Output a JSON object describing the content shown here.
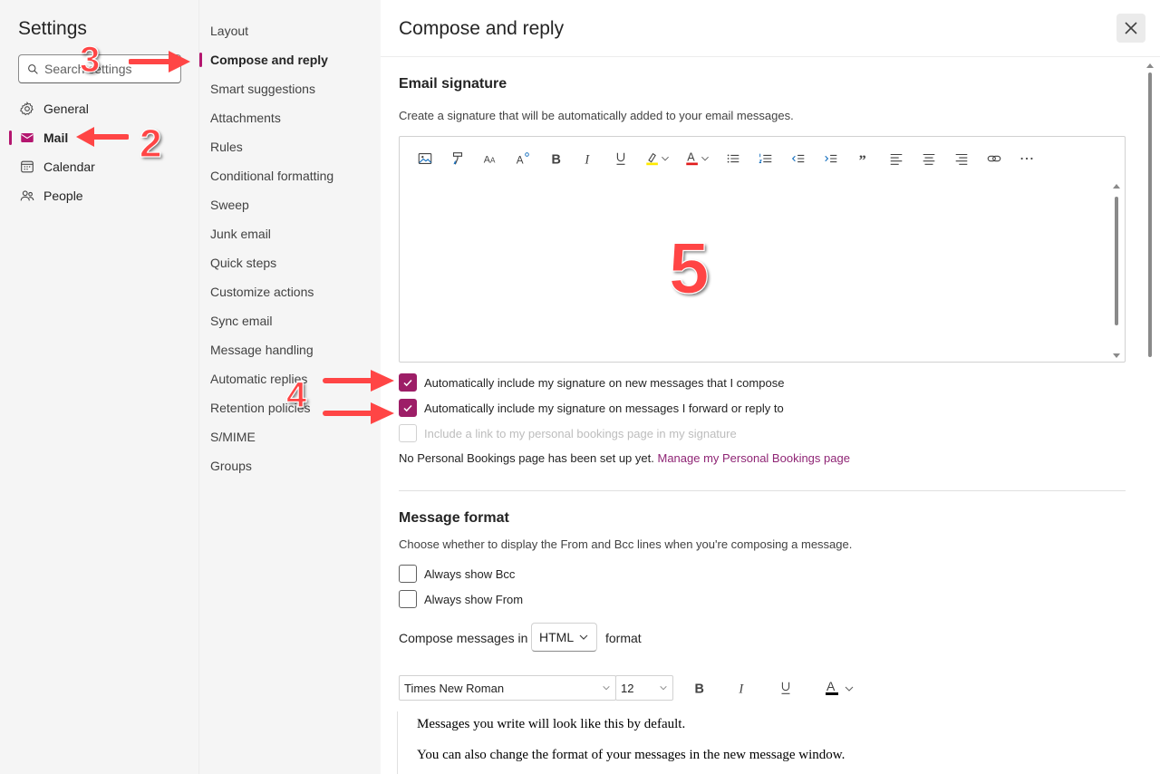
{
  "left_nav": {
    "title": "Settings",
    "search_placeholder": "Search settings",
    "items": [
      {
        "label": "General",
        "icon": "gear-icon"
      },
      {
        "label": "Mail",
        "icon": "mail-icon",
        "active": true
      },
      {
        "label": "Calendar",
        "icon": "calendar-icon"
      },
      {
        "label": "People",
        "icon": "people-icon"
      }
    ]
  },
  "sub_nav": {
    "items": [
      "Layout",
      "Compose and reply",
      "Smart suggestions",
      "Attachments",
      "Rules",
      "Conditional formatting",
      "Sweep",
      "Junk email",
      "Quick steps",
      "Customize actions",
      "Sync email",
      "Message handling",
      "Automatic replies",
      "Retention policies",
      "S/MIME",
      "Groups"
    ],
    "active": "Compose and reply"
  },
  "main": {
    "title": "Compose and reply",
    "close_icon": "close-icon",
    "signature": {
      "heading": "Email signature",
      "description": "Create a signature that will be automatically added to your email messages.",
      "toolbar_icons": [
        "image-icon",
        "format-painter-icon",
        "font-size-icon",
        "superscript-icon",
        "bold-icon",
        "italic-icon",
        "underline-icon",
        "highlight-icon",
        "font-color-icon",
        "bullet-list-icon",
        "numbered-list-icon",
        "decrease-indent-icon",
        "increase-indent-icon",
        "quote-icon",
        "align-left-icon",
        "align-center-icon",
        "align-right-icon",
        "link-icon",
        "more-icon"
      ],
      "checkboxes": [
        {
          "label": "Automatically include my signature on new messages that I compose",
          "checked": true
        },
        {
          "label": "Automatically include my signature on messages I forward or reply to",
          "checked": true
        },
        {
          "label": "Include a link to my personal bookings page in my signature",
          "checked": false,
          "disabled": true
        }
      ],
      "bookings_note": "No Personal Bookings page has been set up yet.",
      "bookings_link": "Manage my Personal Bookings page"
    },
    "message_format": {
      "heading": "Message format",
      "description": "Choose whether to display the From and Bcc lines when you're composing a message.",
      "checkboxes": [
        {
          "label": "Always show Bcc",
          "checked": false
        },
        {
          "label": "Always show From",
          "checked": false
        }
      ],
      "compose_prefix": "Compose messages in",
      "compose_format": "HTML",
      "compose_suffix": "format",
      "font": "Times New Roman",
      "font_size": "12",
      "preview_lines": [
        "Messages you write will look like this by default.",
        "You can also change the format of your messages in the new message window."
      ]
    }
  },
  "annotations": [
    "2",
    "3",
    "4",
    "5"
  ],
  "colors": {
    "accent": "#b4166f",
    "checkbox": "#9d1e67",
    "link": "#8f2575",
    "annotation": "#ff4545"
  }
}
